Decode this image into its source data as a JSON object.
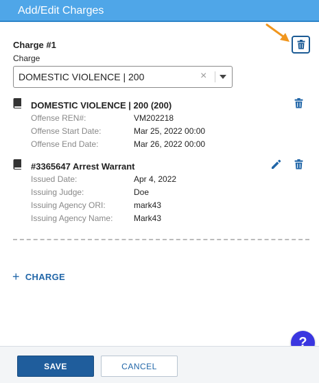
{
  "header": {
    "title": "Add/Edit Charges"
  },
  "charge": {
    "number_label": "Charge #1",
    "field_label": "Charge",
    "select_value": "DOMESTIC VIOLENCE | 200",
    "clear_glyph": "×"
  },
  "items": [
    {
      "icon": "book-icon",
      "title": "DOMESTIC VIOLENCE | 200 (200)",
      "fields": [
        {
          "label": "Offense REN#:",
          "value": "VM202218"
        },
        {
          "label": "Offense Start Date:",
          "value": "Mar 25, 2022 00:00"
        },
        {
          "label": "Offense End Date:",
          "value": "Mar 26, 2022 00:00"
        }
      ],
      "actions": [
        "trash-icon"
      ]
    },
    {
      "icon": "book-icon",
      "title": "#3365647 Arrest Warrant",
      "fields": [
        {
          "label": "Issued Date:",
          "value": "Apr 4, 2022"
        },
        {
          "label": "Issuing Judge:",
          "value": "Doe"
        },
        {
          "label": "Issuing Agency ORI:",
          "value": "mark43"
        },
        {
          "label": "Issuing Agency Name:",
          "value": "Mark43"
        }
      ],
      "actions": [
        "pencil-icon",
        "trash-icon"
      ]
    }
  ],
  "add_charge": {
    "plus": "+",
    "label": "CHARGE"
  },
  "help": {
    "label": "?"
  },
  "footer": {
    "save_label": "SAVE",
    "cancel_label": "CANCEL"
  },
  "colors": {
    "header_bg": "#4fa6e8",
    "primary": "#1f5d9c",
    "link": "#2166a8",
    "help_bg": "#3a36e0",
    "arrow": "#f0961e"
  }
}
